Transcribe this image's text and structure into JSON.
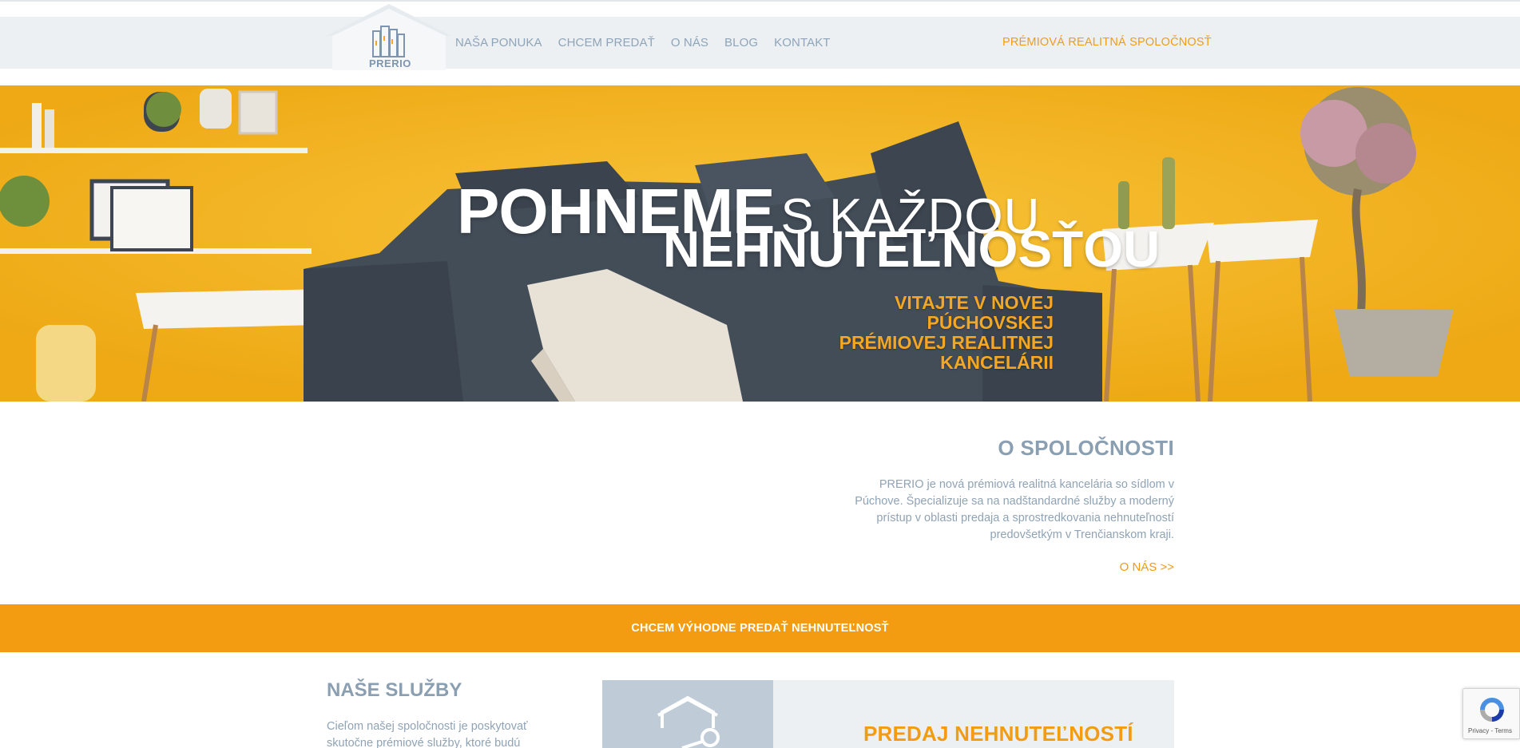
{
  "brand": {
    "name": "PRERIO",
    "tagline": "PRÉMIOVÁ REALITNÁ SPOLOČNOSŤ"
  },
  "nav": {
    "items": [
      {
        "label": "NAŠA PONUKA"
      },
      {
        "label": "CHCEM PREDAŤ"
      },
      {
        "label": "O NÁS"
      },
      {
        "label": "BLOG"
      },
      {
        "label": "KONTAKT"
      }
    ]
  },
  "hero": {
    "headline_bold": "POHNEME",
    "headline_thin": "S KAŽDOU",
    "headline_line2": "NEHNUTEĽNOSŤOU",
    "subline": [
      "VITAJTE V NOVEJ",
      "PÚCHOVSKEJ",
      "PRÉMIOVEJ REALITNEJ",
      "KANCELÁRII"
    ]
  },
  "about": {
    "title": "O SPOLOČNOSTI",
    "text": "PRERIO je nová prémiová realitná kancelária so sídlom v Púchove. Špecializuje sa na nadštandardné služby a moderný prístup v oblasti predaja a sprostredkovania nehnuteľností predovšetkým v Trenčianskom kraji.",
    "link": "O NÁS >>"
  },
  "cta": {
    "label": "CHCEM VÝHODNE PREDAŤ NEHNUTEĽNOSŤ"
  },
  "services": {
    "title": "NAŠE SLUŽBY",
    "text": "Cieľom našej spoločnosti je poskytovať skutočne prémiové služby, ktoré budú",
    "card_title": "PREDAJ NEHNUTEĽNOSTÍ",
    "card_icon": "house-key-icon"
  },
  "recaptcha": {
    "terms": "Privacy - Terms"
  },
  "colors": {
    "accent": "#f39c12",
    "hero_bg": "#f2b21f",
    "header_bg": "#ecf0f3",
    "text": "#8a9fb1"
  }
}
